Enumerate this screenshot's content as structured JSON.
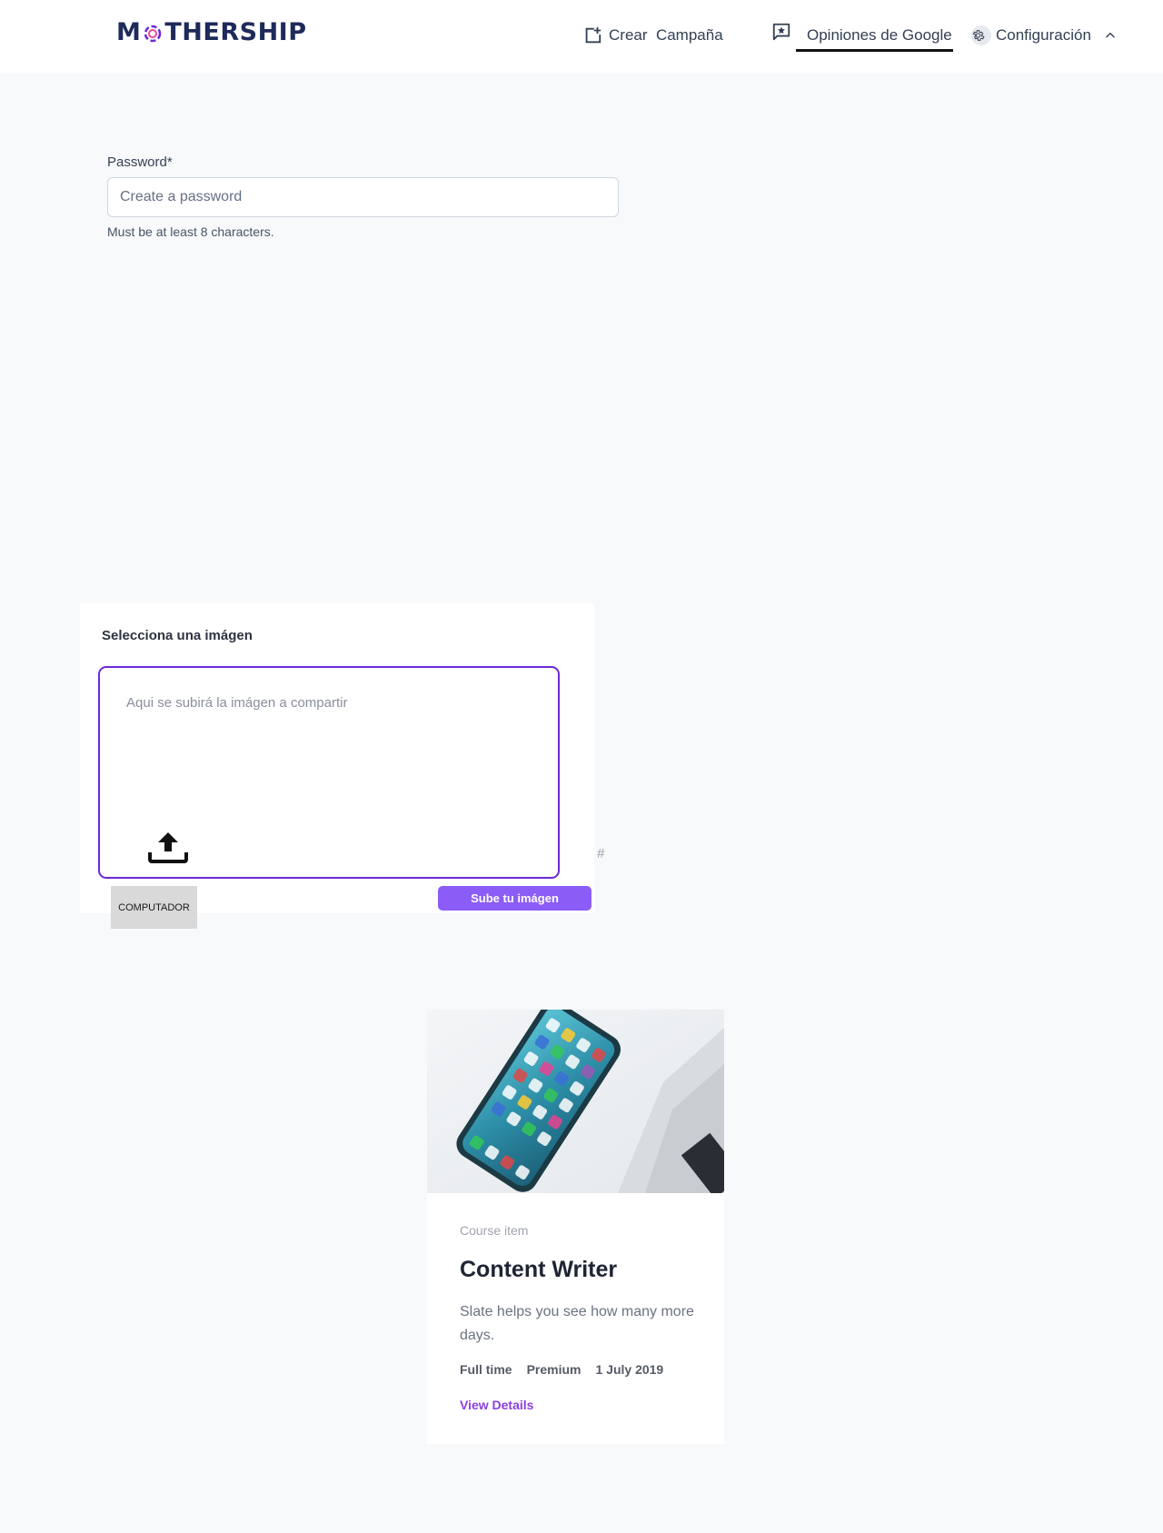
{
  "header": {
    "logo_text_left": "M",
    "logo_text_right": "THERSHIP",
    "nav": {
      "crear_label": "Crear  Campaña",
      "opiniones_label": "Opiniones de Google",
      "config_label": "Configuración"
    },
    "icons": [
      "add-box-icon",
      "review-star-icon",
      "gear-icon",
      "chevron-up-icon"
    ]
  },
  "password": {
    "label": "Password*",
    "placeholder": "Create a password",
    "value": "",
    "hint": "Must be at least 8 characters."
  },
  "upload": {
    "title": "Selecciona una imágen",
    "placeholder": "Aqui se subirá la imágen a compartir",
    "hash": "#",
    "computador_label": "COMPUTADOR",
    "submit_label": "Sube tu imágen",
    "accent_color": "#6d28d9",
    "button_color": "#8b5cf6"
  },
  "course": {
    "eyebrow": "Course item",
    "title": "Content Writer",
    "description": "Slate helps you see how many more days.",
    "meta": [
      "Full time",
      "Premium",
      "1 July 2019"
    ],
    "link_label": "View Details",
    "link_color": "#8b3fe0"
  }
}
